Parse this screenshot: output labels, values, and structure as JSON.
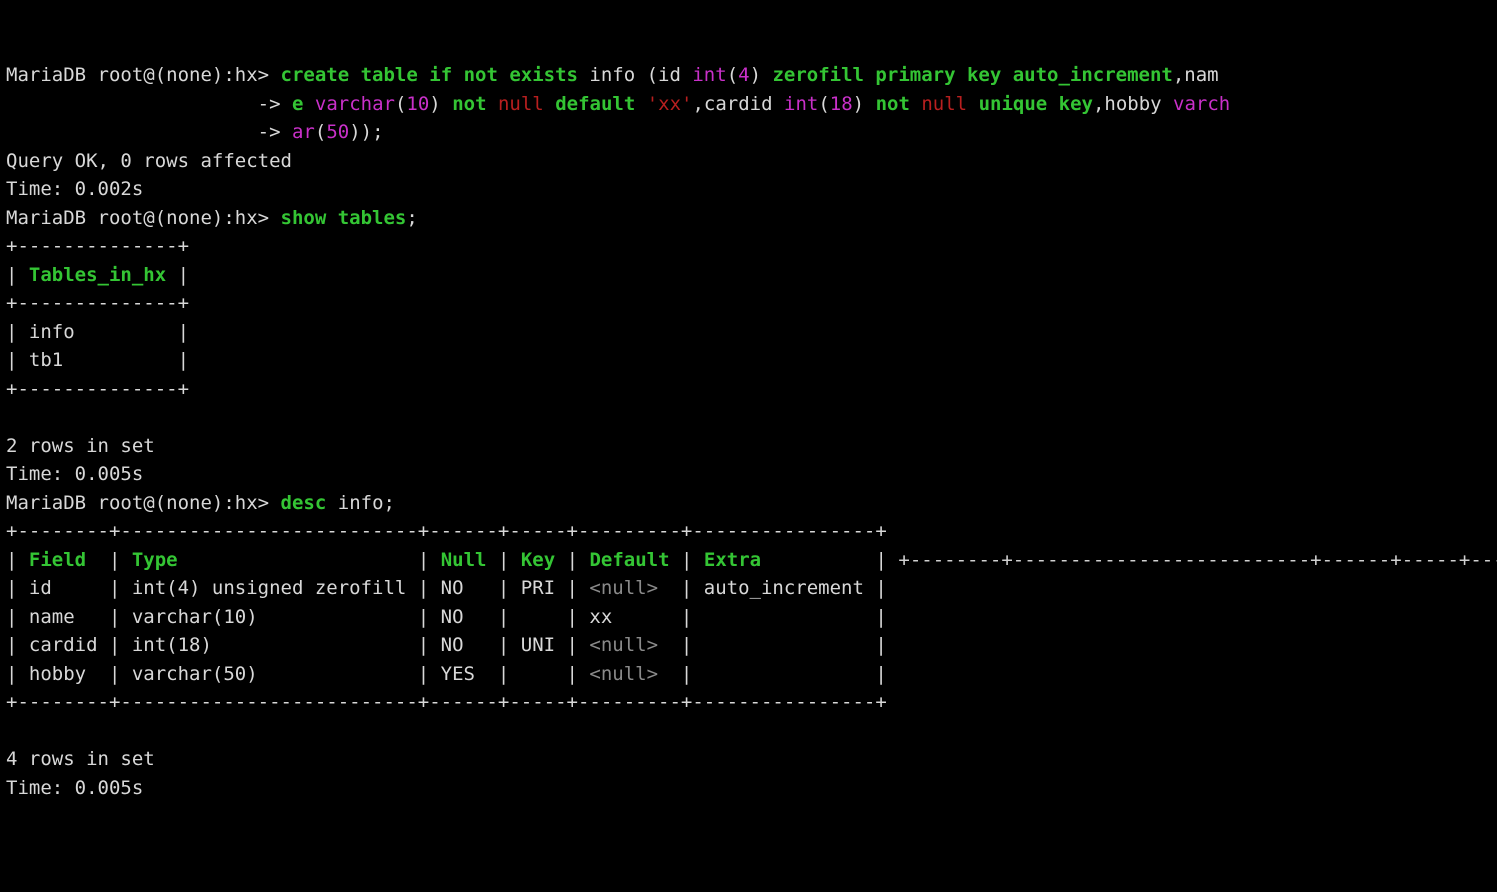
{
  "prompt": "MariaDB root@(none):hx> ",
  "cont": "                      -> ",
  "cmd1": {
    "l1": {
      "a": "create table if not exists",
      "b": " info (id ",
      "c": "int",
      "d": "(",
      "e": "4",
      "f": ") ",
      "g": "zerofill primary key auto_increment",
      "h": ",nam"
    },
    "l2": {
      "a": "e ",
      "b": "varchar",
      "c": "(",
      "d": "10",
      "e": ") ",
      "f": "not",
      "g": " ",
      "h": "null",
      "i": " ",
      "j": "default",
      "k": " ",
      "l": "'xx'",
      "m": ",cardid ",
      "n": "int",
      "o": "(",
      "p": "18",
      "q": ") ",
      "r": "not",
      "s": " ",
      "t": "null",
      "u": " ",
      "v": "unique key",
      "w": ",hobby ",
      "x": "varch"
    },
    "l3": {
      "a": "ar",
      "b": "(",
      "c": "50",
      "d": "));"
    }
  },
  "r1": {
    "ok": "Query OK, 0 rows affected",
    "time": "Time: 0.002s"
  },
  "cmd2": {
    "a": "show tables",
    "b": ";"
  },
  "t1": {
    "border": "+--------------+",
    "header": "Tables_in_hx",
    "rows": [
      "info",
      "tb1"
    ],
    "summary": "2 rows in set",
    "time": "Time: 0.005s"
  },
  "cmd3": {
    "a": "desc",
    "b": " info;"
  },
  "t2": {
    "border": "+--------+--------------------------+------+-----+---------+----------------+",
    "headers": [
      "Field",
      "Type",
      "Null",
      "Key",
      "Default",
      "Extra"
    ],
    "rows": [
      {
        "f": "id",
        "t": "int(4) unsigned zerofill",
        "n": "NO",
        "k": "PRI",
        "d": "<null>",
        "e": "auto_increment",
        "dnull": true
      },
      {
        "f": "name",
        "t": "varchar(10)",
        "n": "NO",
        "k": "",
        "d": "xx",
        "e": "",
        "dnull": false
      },
      {
        "f": "cardid",
        "t": "int(18)",
        "n": "NO",
        "k": "UNI",
        "d": "<null>",
        "e": "",
        "dnull": true
      },
      {
        "f": "hobby",
        "t": "varchar(50)",
        "n": "YES",
        "k": "",
        "d": "<null>",
        "e": "",
        "dnull": true
      }
    ],
    "summary": "4 rows in set",
    "time": "Time: 0.005s"
  }
}
